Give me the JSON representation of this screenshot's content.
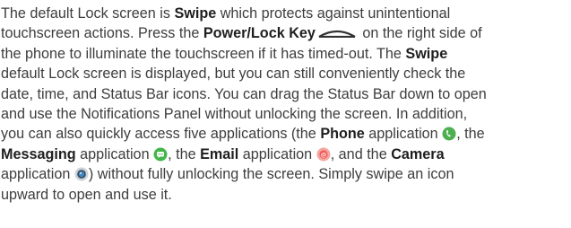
{
  "paragraph": {
    "l1": [
      "The default Lock screen is ",
      "Swipe",
      " which protects against unintentional"
    ],
    "l2": [
      "touchscreen actions. Press the ",
      "Power/Lock Key",
      " on the right side of"
    ],
    "l3": [
      "the phone to illuminate the touchscreen if it has timed-out. The ",
      "Swipe"
    ],
    "l4": [
      "default Lock screen is displayed, but you can still conveniently check the"
    ],
    "l5": [
      "date, time, and Status Bar icons. You can drag the Status Bar down to open"
    ],
    "l6": [
      "and use the Notifications Panel without unlocking the screen. In addition,"
    ],
    "l7": [
      "you can also quickly access five applications (the ",
      "Phone",
      " application ",
      ", the"
    ],
    "l8": [
      "Messaging",
      " application ",
      ", the ",
      "Email",
      " application ",
      ", and the ",
      "Camera"
    ],
    "l9": [
      "application ",
      ") without fully unlocking the screen. Simply swipe an icon"
    ],
    "l10": [
      "upward to open and use it."
    ]
  },
  "icons": {
    "power_key": "power-lock-key-icon",
    "phone": "phone-app-icon",
    "messaging": "messaging-app-icon",
    "email": "email-app-icon",
    "camera": "camera-app-icon"
  },
  "colors": {
    "text": "#3d3d3d",
    "bold_text": "#1f1f1f",
    "phone_icon": "#4caf50",
    "messaging_icon": "#43b649",
    "email_icon": "#f15a5a",
    "camera_icon": "#3e86c9"
  }
}
